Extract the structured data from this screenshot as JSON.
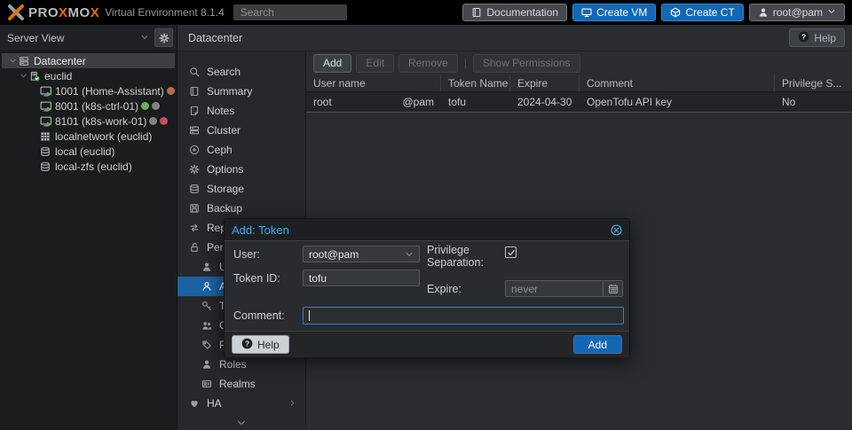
{
  "topbar": {
    "brand_segments": [
      {
        "text": "PRO",
        "orange": false
      },
      {
        "text": "X",
        "orange": true
      },
      {
        "text": "MO",
        "orange": false
      },
      {
        "text": "X",
        "orange": true
      }
    ],
    "version": "Virtual Environment 8.1.4",
    "search_placeholder": "Search",
    "buttons": [
      {
        "id": "documentation",
        "label": "Documentation",
        "icon": "book-icon",
        "style": "gray",
        "caret": false
      },
      {
        "id": "create-vm",
        "label": "Create VM",
        "icon": "monitor-icon",
        "style": "blue",
        "caret": false
      },
      {
        "id": "create-ct",
        "label": "Create CT",
        "icon": "cube-icon",
        "style": "blue",
        "caret": false
      },
      {
        "id": "user-menu",
        "label": "root@pam",
        "icon": "user-icon",
        "style": "gray",
        "caret": true
      }
    ]
  },
  "sidebar": {
    "view_selector": "Server View",
    "tree": [
      {
        "label": "Datacenter",
        "icon": "datacenter",
        "level": 0,
        "selected": true,
        "expandable": true,
        "dots": []
      },
      {
        "label": "euclid",
        "icon": "node",
        "level": 1,
        "selected": false,
        "expandable": true,
        "dots": []
      },
      {
        "label": "1001 (Home-Assistant)",
        "icon": "vm-running",
        "level": 2,
        "selected": false,
        "expandable": false,
        "dots": [
          "#B06C4C",
          "#C5A284"
        ]
      },
      {
        "label": "8001 (k8s-ctrl-01)",
        "icon": "vm-running",
        "level": 2,
        "selected": false,
        "expandable": false,
        "dots": [
          "#6CAF5B",
          "#808284"
        ]
      },
      {
        "label": "8101 (k8s-work-01)",
        "icon": "vm-running",
        "level": 2,
        "selected": false,
        "expandable": false,
        "dots": [
          "#808284",
          "#C05059"
        ]
      },
      {
        "label": "localnetwork (euclid)",
        "icon": "network",
        "level": 2,
        "selected": false,
        "expandable": false,
        "dots": []
      },
      {
        "label": "local (euclid)",
        "icon": "storage",
        "level": 2,
        "selected": false,
        "expandable": false,
        "dots": []
      },
      {
        "label": "local-zfs (euclid)",
        "icon": "storage",
        "level": 2,
        "selected": false,
        "expandable": false,
        "dots": []
      }
    ]
  },
  "content_header": {
    "title": "Datacenter",
    "help_label": "Help"
  },
  "menu": {
    "items": [
      {
        "label": "Search",
        "icon": "search",
        "indent": false,
        "selected": false,
        "arrow": false
      },
      {
        "label": "Summary",
        "icon": "book",
        "indent": false,
        "selected": false,
        "arrow": false
      },
      {
        "label": "Notes",
        "icon": "note",
        "indent": false,
        "selected": false,
        "arrow": false
      },
      {
        "label": "Cluster",
        "icon": "cluster",
        "indent": false,
        "selected": false,
        "arrow": false
      },
      {
        "label": "Ceph",
        "icon": "ceph",
        "indent": false,
        "selected": false,
        "arrow": false
      },
      {
        "label": "Options",
        "icon": "gear",
        "indent": false,
        "selected": false,
        "arrow": false
      },
      {
        "label": "Storage",
        "icon": "storage",
        "indent": false,
        "selected": false,
        "arrow": false
      },
      {
        "label": "Backup",
        "icon": "backup",
        "indent": false,
        "selected": false,
        "arrow": false
      },
      {
        "label": "Replication",
        "icon": "replication",
        "indent": false,
        "selected": false,
        "arrow": false
      },
      {
        "label": "Permissions",
        "icon": "permissions",
        "indent": false,
        "selected": false,
        "arrow": false
      },
      {
        "label": "Users",
        "icon": "user-solid",
        "indent": true,
        "selected": false,
        "arrow": false
      },
      {
        "label": "API Tokens",
        "icon": "user-outline",
        "indent": true,
        "selected": true,
        "arrow": false
      },
      {
        "label": "Two Factor",
        "icon": "key",
        "indent": true,
        "selected": false,
        "arrow": false
      },
      {
        "label": "Groups",
        "icon": "group",
        "indent": true,
        "selected": false,
        "arrow": false
      },
      {
        "label": "Pools",
        "icon": "tag",
        "indent": true,
        "selected": false,
        "arrow": false
      },
      {
        "label": "Roles",
        "icon": "user-solid",
        "indent": true,
        "selected": false,
        "arrow": false
      },
      {
        "label": "Realms",
        "icon": "idcard",
        "indent": true,
        "selected": false,
        "arrow": false
      },
      {
        "label": "HA",
        "icon": "ha",
        "indent": false,
        "selected": false,
        "arrow": true
      }
    ]
  },
  "tokens_view": {
    "toolbar": [
      {
        "label": "Add",
        "enabled": true,
        "separator": false
      },
      {
        "label": "Edit",
        "enabled": false,
        "separator": false
      },
      {
        "label": "Remove",
        "enabled": false,
        "separator": false
      },
      {
        "label": "",
        "enabled": false,
        "separator": true
      },
      {
        "label": "Show Permissions",
        "enabled": false,
        "separator": false
      }
    ],
    "columns": [
      "User name",
      "Token Name",
      "Expire",
      "Comment",
      "Privilege S..."
    ],
    "rows": [
      {
        "user": "root",
        "realm": "@pam",
        "token": "tofu",
        "expire": "2024-04-30",
        "comment": "OpenTofu API key",
        "privilege": "No"
      }
    ]
  },
  "dialog": {
    "title": "Add: Token",
    "fields": {
      "user_label": "User:",
      "user_value": "root@pam",
      "tokenid_label": "Token ID:",
      "tokenid_value": "tofu",
      "priv_label": "Privilege Separation:",
      "priv_checked": true,
      "expire_label": "Expire:",
      "expire_value": "never",
      "comment_label": "Comment:",
      "comment_value": ""
    },
    "help_label": "Help",
    "submit_label": "Add"
  },
  "colors": {
    "brand_orange": "#E57000",
    "accent_blue": "#1467B3",
    "selection_blue": "#1B62A2",
    "title_blue": "#3FA9E3",
    "running_green": "#5CB85C"
  }
}
